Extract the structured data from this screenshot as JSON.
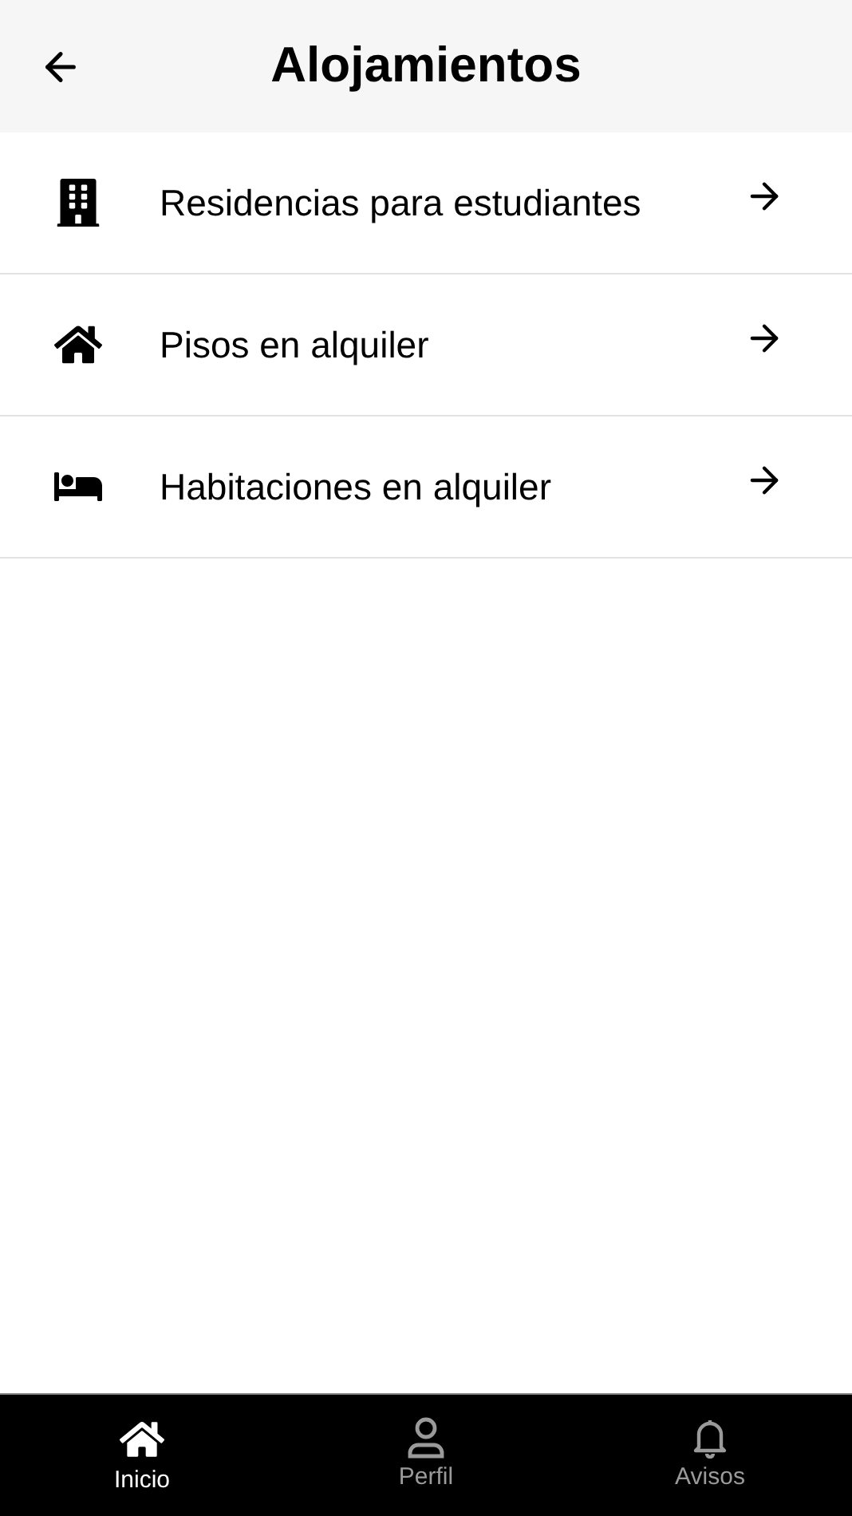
{
  "header": {
    "title": "Alojamientos"
  },
  "items": [
    {
      "kind": "building",
      "label": "Residencias para estudiantes"
    },
    {
      "kind": "house",
      "label": "Pisos en alquiler"
    },
    {
      "kind": "bed",
      "label": "Habitaciones en alquiler"
    }
  ],
  "tab_bar": [
    {
      "kind": "home",
      "label": "Inicio",
      "selected": true
    },
    {
      "kind": "profile",
      "label": "Perfil",
      "selected": false
    },
    {
      "kind": "bell",
      "label": "Avisos",
      "selected": false
    }
  ]
}
